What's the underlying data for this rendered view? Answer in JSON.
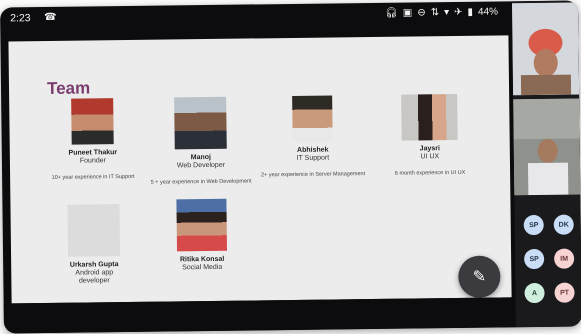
{
  "statusbar": {
    "time": "2:23",
    "battery": "44%"
  },
  "slide": {
    "title": "Team",
    "members": [
      {
        "name": "Puneet Thakur",
        "role": "Founder",
        "experience": "10+ year experience in IT Support"
      },
      {
        "name": "Manoj",
        "role": "Web Developer",
        "experience": "5 + year experience in Web Development"
      },
      {
        "name": "Abhishek",
        "role": "IT Support",
        "experience": "2+ year experience in Server Management"
      },
      {
        "name": "Jaysri",
        "role": "UI UX",
        "experience": "6 month experience in UI UX"
      },
      {
        "name": "Urkarsh Gupta",
        "role": "Android app developer",
        "experience": ""
      },
      {
        "name": "Ritika Konsal",
        "role": "Social Media",
        "experience": ""
      }
    ]
  },
  "participants": [
    {
      "initials": "SP",
      "color": "#c9ddf7",
      "text": "#234"
    },
    {
      "initials": "DK",
      "color": "#c9ddf7",
      "text": "#234"
    },
    {
      "initials": "SP",
      "color": "#c9ddf7",
      "text": "#234"
    },
    {
      "initials": "IM",
      "color": "#f7d3d3",
      "text": "#633"
    },
    {
      "initials": "A",
      "color": "#cfeede",
      "text": "#243"
    },
    {
      "initials": "PT",
      "color": "#f7d3d3",
      "text": "#633"
    }
  ],
  "colors": {
    "title": "#7a3c6e",
    "fab": "#3a3a3f"
  }
}
